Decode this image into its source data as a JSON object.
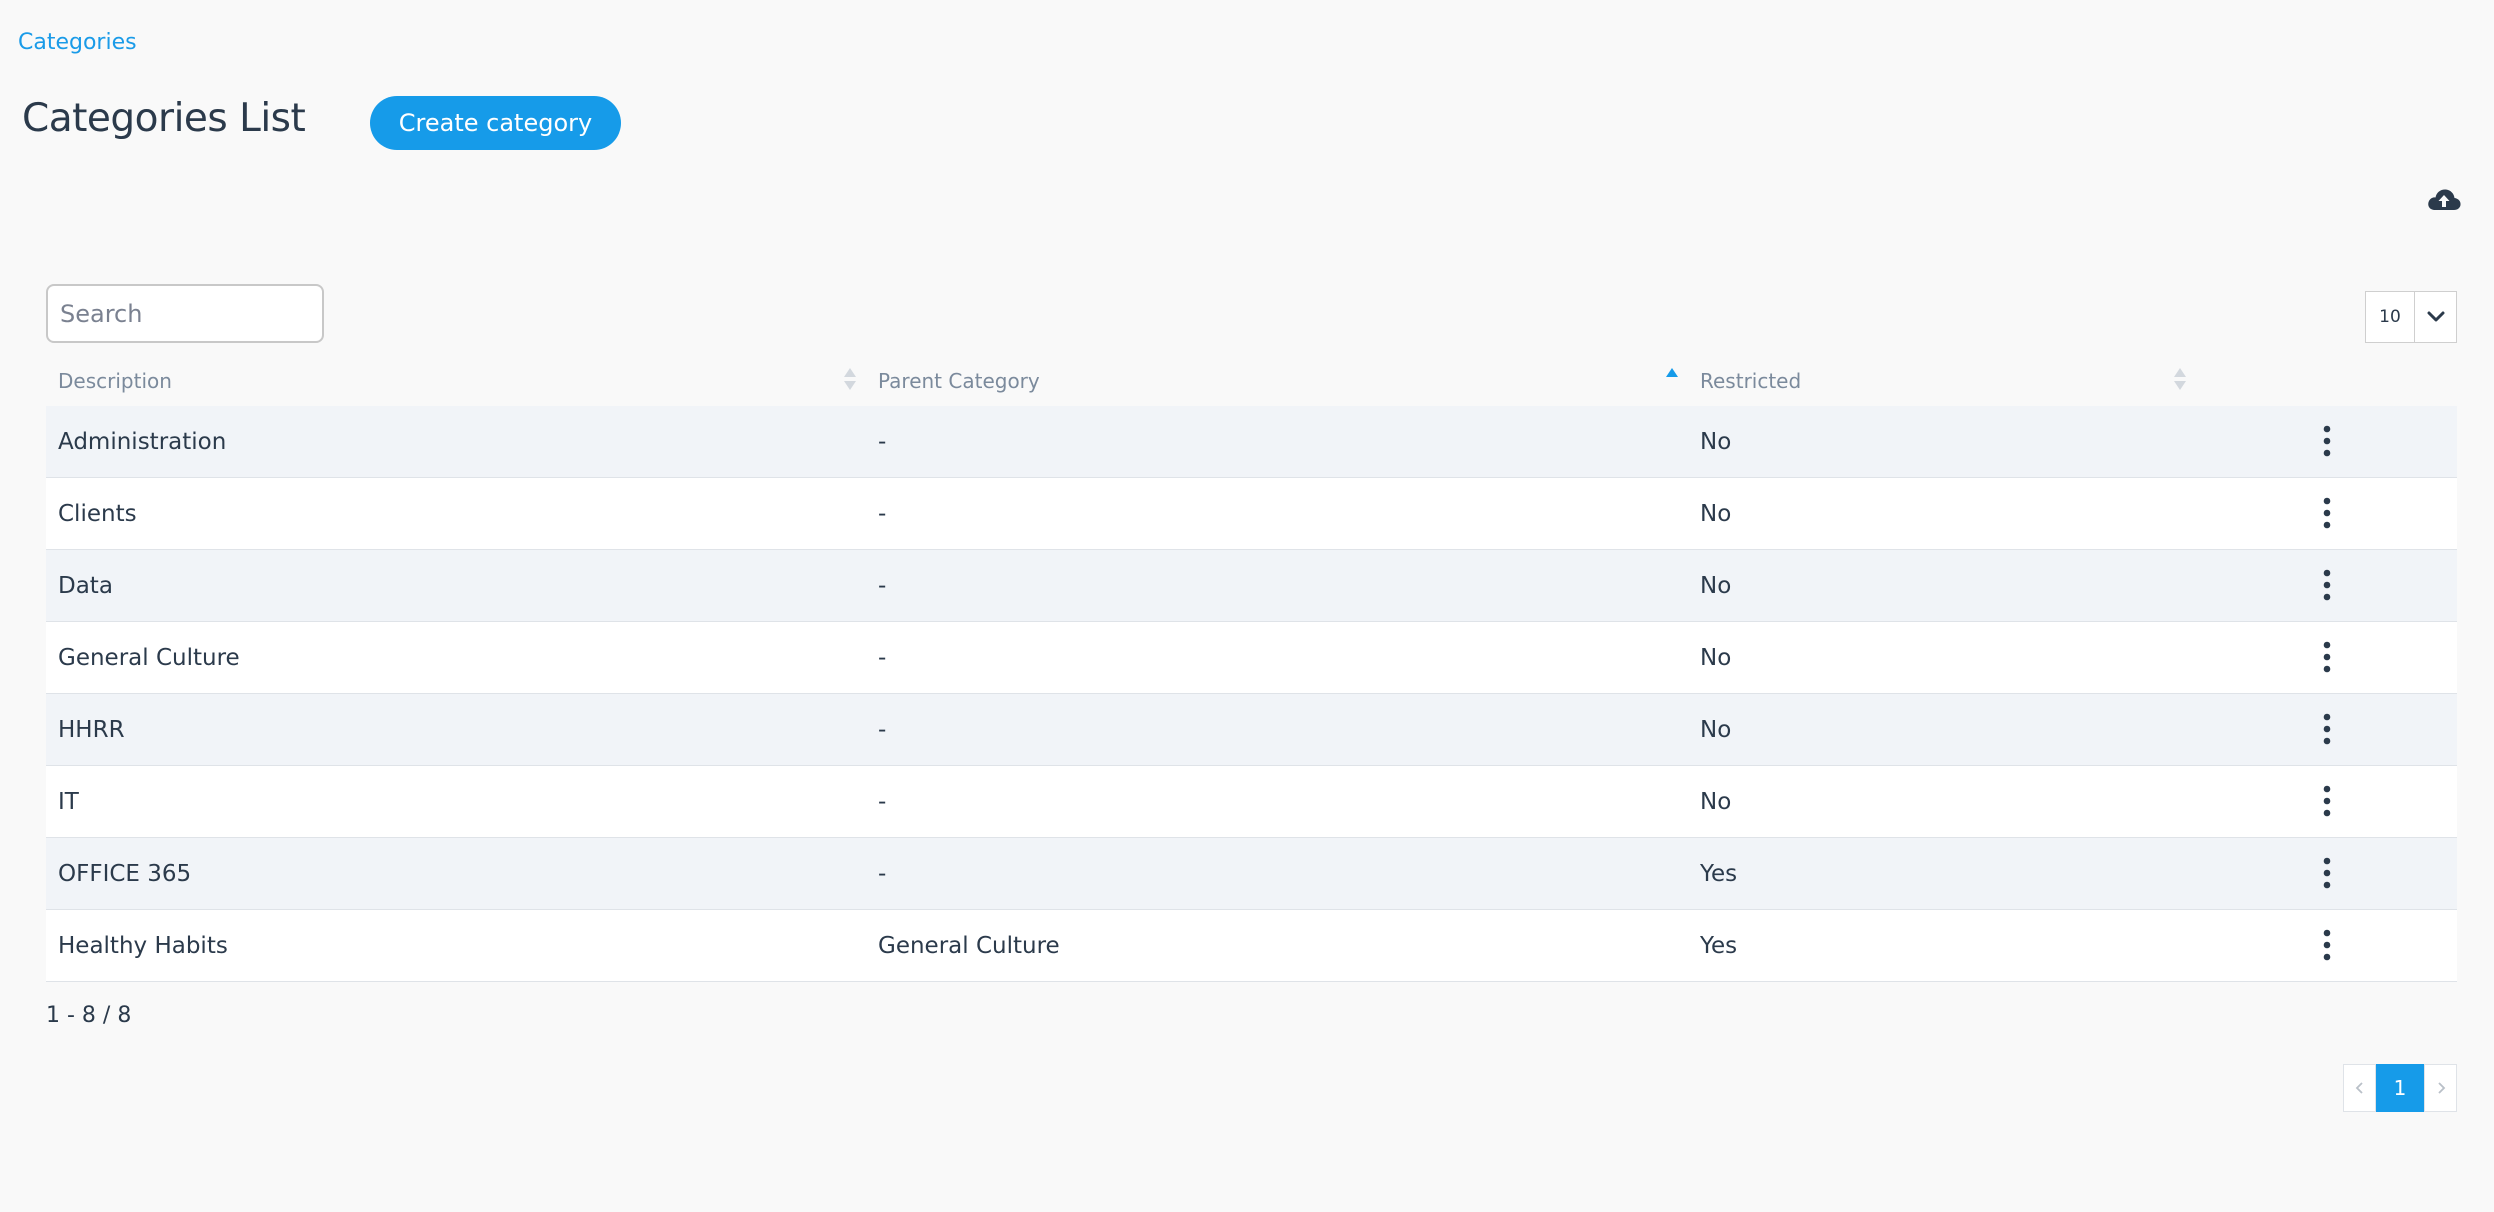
{
  "breadcrumb": {
    "label": "Categories"
  },
  "header": {
    "title": "Categories List",
    "create_label": "Create category"
  },
  "toolbar": {
    "upload_icon": "cloud-upload-icon",
    "search_placeholder": "Search",
    "page_size": "10"
  },
  "table": {
    "columns": [
      {
        "label": "Description",
        "sort": "none"
      },
      {
        "label": "Parent Category",
        "sort": "ascending"
      },
      {
        "label": "Restricted",
        "sort": "none"
      }
    ],
    "rows": [
      {
        "description": "Administration",
        "parent": "-",
        "restricted": "No"
      },
      {
        "description": "Clients",
        "parent": "-",
        "restricted": "No"
      },
      {
        "description": "Data",
        "parent": "-",
        "restricted": "No"
      },
      {
        "description": "General Culture",
        "parent": "-",
        "restricted": "No"
      },
      {
        "description": "HHRR",
        "parent": "-",
        "restricted": "No"
      },
      {
        "description": "IT",
        "parent": "-",
        "restricted": "No"
      },
      {
        "description": "OFFICE 365",
        "parent": "-",
        "restricted": "Yes"
      },
      {
        "description": "Healthy Habits",
        "parent": "General Culture",
        "restricted": "Yes"
      }
    ]
  },
  "footer": {
    "count_text": "1 - 8 / 8",
    "current_page": "1"
  },
  "colors": {
    "accent": "#169be9",
    "text": "#2b3a4b",
    "header_text": "#7b8a9c",
    "row_alt": "#f1f4f8"
  }
}
